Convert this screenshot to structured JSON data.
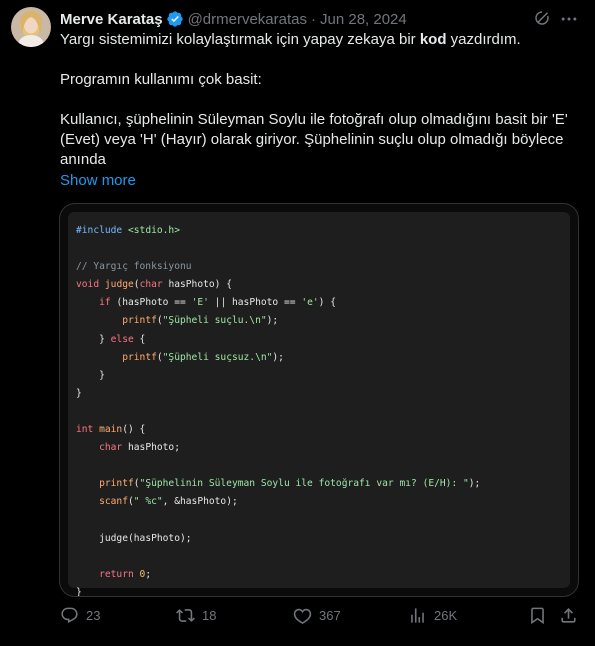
{
  "author": {
    "name": "Merve Karataş",
    "handle": "@drmervekaratas",
    "separator": "·",
    "date": "Jun 28, 2024"
  },
  "body": {
    "line1_pre": "Yargı sistemimizi kolaylaştırmak için yapay zekaya bir ",
    "line1_bold": "kod",
    "line1_post": " yazdırdım.",
    "para2": "Programın kullanımı çok basit:",
    "para3": "Kullanıcı, şüphelinin Süleyman Soylu ile fotoğrafı olup olmadığını basit bir 'E' (Evet) veya 'H' (Hayır) olarak giriyor. Şüphelinin suçlu olup olmadığı böylece anında",
    "show_more": "Show more"
  },
  "code": {
    "include_kw": "#include",
    "include_hdr": "<stdio.h>",
    "comment": "// Yargıç fonksiyonu",
    "kw_void": "void",
    "fn_judge": "judge",
    "kw_char": "char",
    "param": "hasPhoto",
    "kw_if": "if",
    "str_E": "'E'",
    "str_e": "'e'",
    "fn_printf": "printf",
    "str_guilty": "\"Şüpheli suçlu.\\n\"",
    "kw_else": "else",
    "str_innocent": "\"Şüpheli suçsuz.\\n\"",
    "kw_int": "int",
    "fn_main": "main",
    "str_prompt": "\"Şüphelinin Süleyman Soylu ile fotoğrafı var mı? (E/H): \"",
    "fn_scanf": "scanf",
    "str_fmt": "\" %c\"",
    "kw_return": "return",
    "zero": "0"
  },
  "actions": {
    "replies": "23",
    "reposts": "18",
    "likes": "367",
    "views": "26K"
  },
  "icons": [
    "grok-icon",
    "more-icon",
    "reply-icon",
    "repost-icon",
    "like-icon",
    "views-icon",
    "bookmark-icon",
    "share-icon"
  ],
  "colors": {
    "accent": "#1d9bf0",
    "muted": "#71767b",
    "text": "#e7e9ea",
    "background": "#000000"
  }
}
